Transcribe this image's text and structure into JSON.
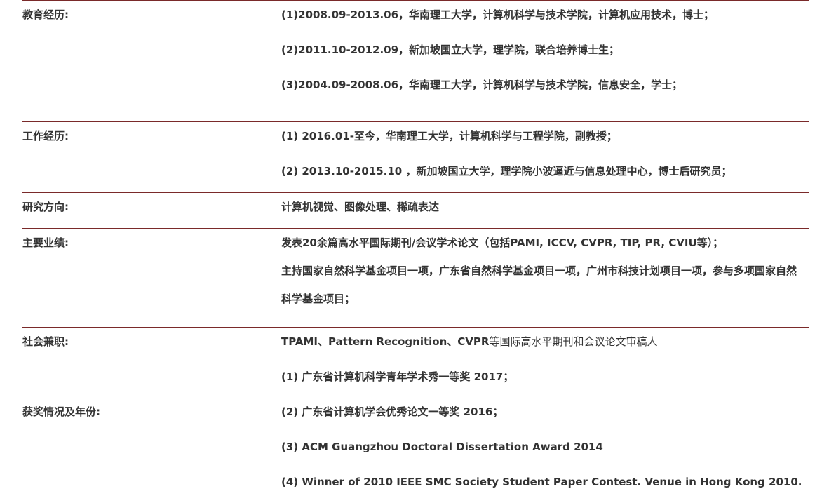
{
  "education": {
    "label": "教育经历:",
    "items": [
      "(1)2008.09-2013.06，华南理工大学，计算机科学与技术学院，计算机应用技术，博士；",
      "(2)2011.10-2012.09，新加坡国立大学，理学院，联合培养博士生；",
      "(3)2004.09-2008.06，华南理工大学，计算机科学与技术学院，信息安全，学士；"
    ]
  },
  "work": {
    "label": "工作经历:",
    "items": [
      "(1)  2016.01-至今，华南理工大学，计算机科学与工程学院，副教授；",
      "(2)  2013.10-2015.10 ，新加坡国立大学，理学院小波逼近与信息处理中心，博士后研究员；"
    ]
  },
  "research": {
    "label": "研究方向:",
    "value": "计算机视觉、图像处理、稀疏表达"
  },
  "achievements": {
    "label": "主要业绩:",
    "items": [
      "发表20余篇高水平国际期刊/会议学术论文（包括PAMI, ICCV, CVPR, TIP, PR, CVIU等）；",
      "主持国家自然科学基金项目一项，广东省自然科学基金项目一项，广州市科技计划项目一项，参与多项国家自然科学基金项目；"
    ]
  },
  "service": {
    "label": "社会兼职:",
    "value_bold": "TPAMI、Pattern Recognition、CVPR",
    "value_rest": "等国际高水平期刊和会议论文审稿人"
  },
  "awards": {
    "label": "获奖情况及年份:",
    "items": [
      "(1) 广东省计算机科学青年学术秀一等奖 2017；",
      "(2) 广东省计算机学会优秀论文一等奖 2016；",
      "(3)  ACM Guangzhou Doctoral Dissertation Award 2014",
      "(4) Winner of 2010 IEEE SMC Society Student Paper Contest.  Venue in Hong Kong 2010."
    ]
  },
  "colors": {
    "divider": "#7a2a2a",
    "text": "#333333",
    "background": "#ffffff"
  }
}
